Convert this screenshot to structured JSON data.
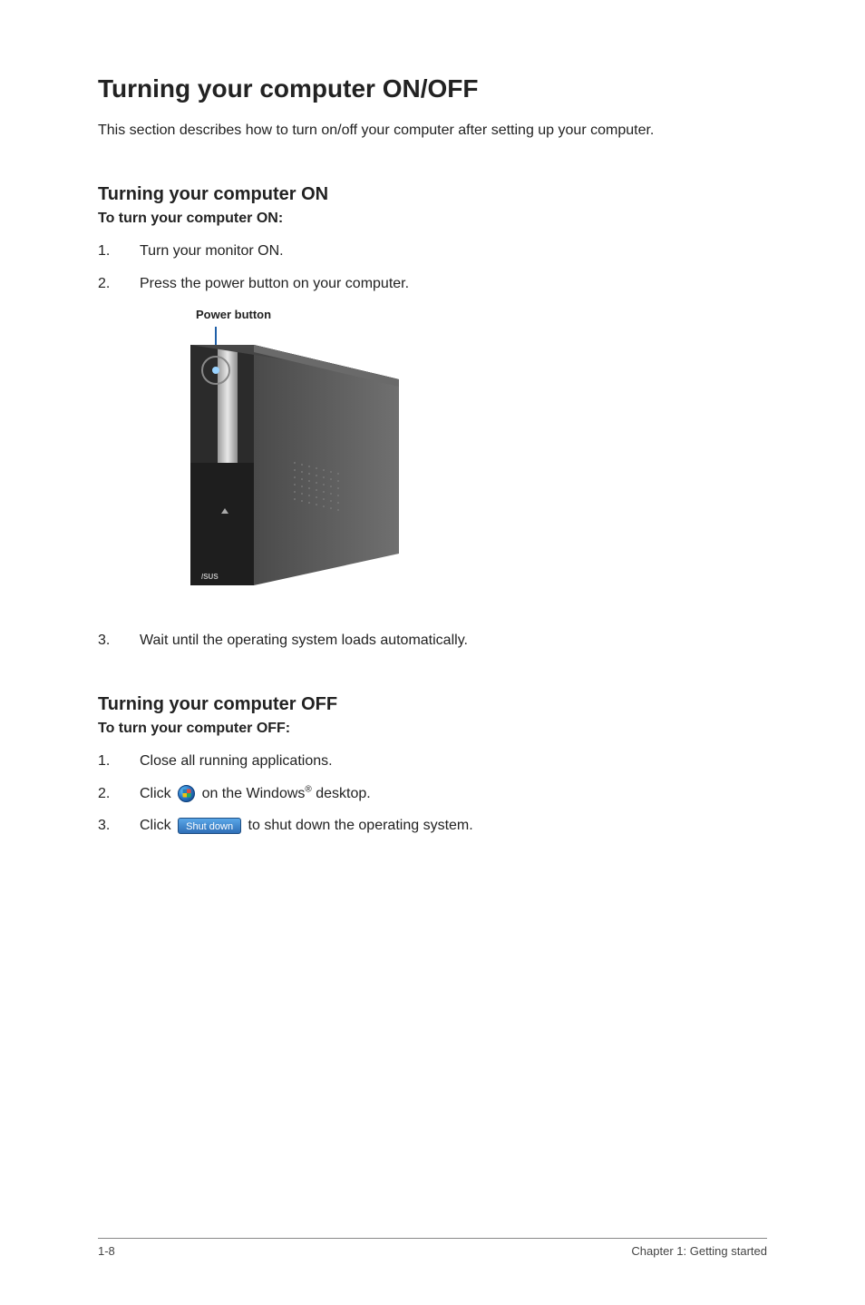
{
  "headings": {
    "main": "Turning your computer ON/OFF",
    "intro": "This section describes how to turn on/off your computer after setting up your computer.",
    "on_heading": "Turning your computer ON",
    "on_sub": "To turn your computer ON:",
    "off_heading": "Turning your computer OFF",
    "off_sub": "To turn your computer OFF:"
  },
  "on_steps": {
    "s1": {
      "num": "1.",
      "text": "Turn your monitor ON."
    },
    "s2": {
      "num": "2.",
      "text": "Press the power button on your computer."
    },
    "s3": {
      "num": "3.",
      "text": "Wait until the operating system loads automatically."
    }
  },
  "off_steps": {
    "s1": {
      "num": "1.",
      "text": "Close all running applications."
    },
    "s2": {
      "num": "2.",
      "text_before": "Click ",
      "text_after_a": " on the Windows",
      "text_after_b": " desktop."
    },
    "s3": {
      "num": "3.",
      "text_before": "Click ",
      "btn_label": "Shut down",
      "text_after": " to shut down the operating system."
    }
  },
  "figure": {
    "label": "Power button"
  },
  "footer": {
    "left": "1-8",
    "right": "Chapter 1: Getting started"
  },
  "misc": {
    "reg": "®"
  }
}
